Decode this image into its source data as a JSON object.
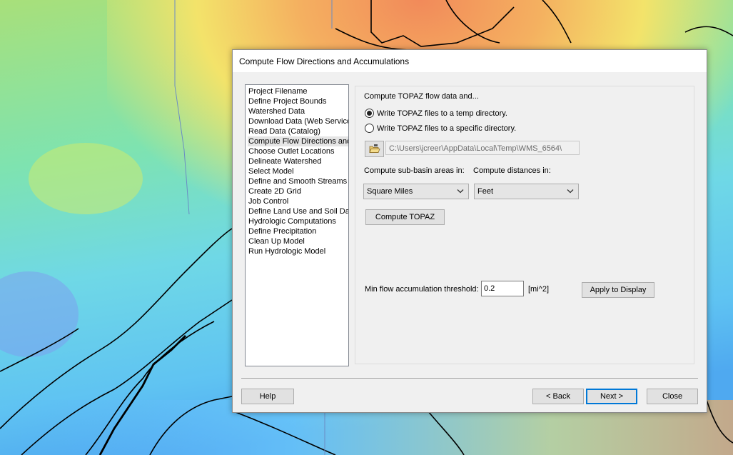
{
  "dialog": {
    "title": "Compute Flow Directions and Accumulations"
  },
  "steps": {
    "items": [
      {
        "label": "Project Filename"
      },
      {
        "label": "Define Project Bounds"
      },
      {
        "label": "Watershed Data"
      },
      {
        "label": "Download Data (Web Service"
      },
      {
        "label": "Read Data (Catalog)"
      },
      {
        "label": "Compute Flow Directions and"
      },
      {
        "label": "Choose Outlet Locations"
      },
      {
        "label": "Delineate Watershed"
      },
      {
        "label": "Select Model"
      },
      {
        "label": "Define and Smooth Streams"
      },
      {
        "label": "Create 2D Grid"
      },
      {
        "label": "Job Control"
      },
      {
        "label": "Define Land Use and Soil Dat"
      },
      {
        "label": "Hydrologic Computations"
      },
      {
        "label": "Define Precipitation"
      },
      {
        "label": "Clean Up Model"
      },
      {
        "label": "Run Hydrologic Model"
      }
    ],
    "selected_index": 5
  },
  "panel": {
    "heading": "Compute TOPAZ flow data and...",
    "radio_temp": {
      "label": "Write TOPAZ files to a temp directory.",
      "checked": true
    },
    "radio_specific": {
      "label": "Write TOPAZ files to a specific directory.",
      "checked": false
    },
    "directory_path": "C:\\Users\\jcreer\\AppData\\Local\\Temp\\WMS_6564\\",
    "subbasin_label": "Compute sub-basin areas in:",
    "subbasin_value": "Square Miles",
    "distance_label": "Compute distances in:",
    "distance_value": "Feet",
    "compute_button": "Compute TOPAZ",
    "threshold_label": "Min flow accumulation threshold:",
    "threshold_value": "0.2",
    "threshold_unit": "[mi^2]",
    "apply_button": "Apply to Display"
  },
  "footer": {
    "help": "Help",
    "back": "< Back",
    "next": "Next >",
    "close": "Close"
  },
  "icons": {
    "folder": "folder-open-icon",
    "dropdown": "chevron-down-icon"
  },
  "colors": {
    "dialog_bg": "#f0f0f0",
    "default_button_border": "#0078d7",
    "selected_item_bg": "#e5e5e5"
  }
}
